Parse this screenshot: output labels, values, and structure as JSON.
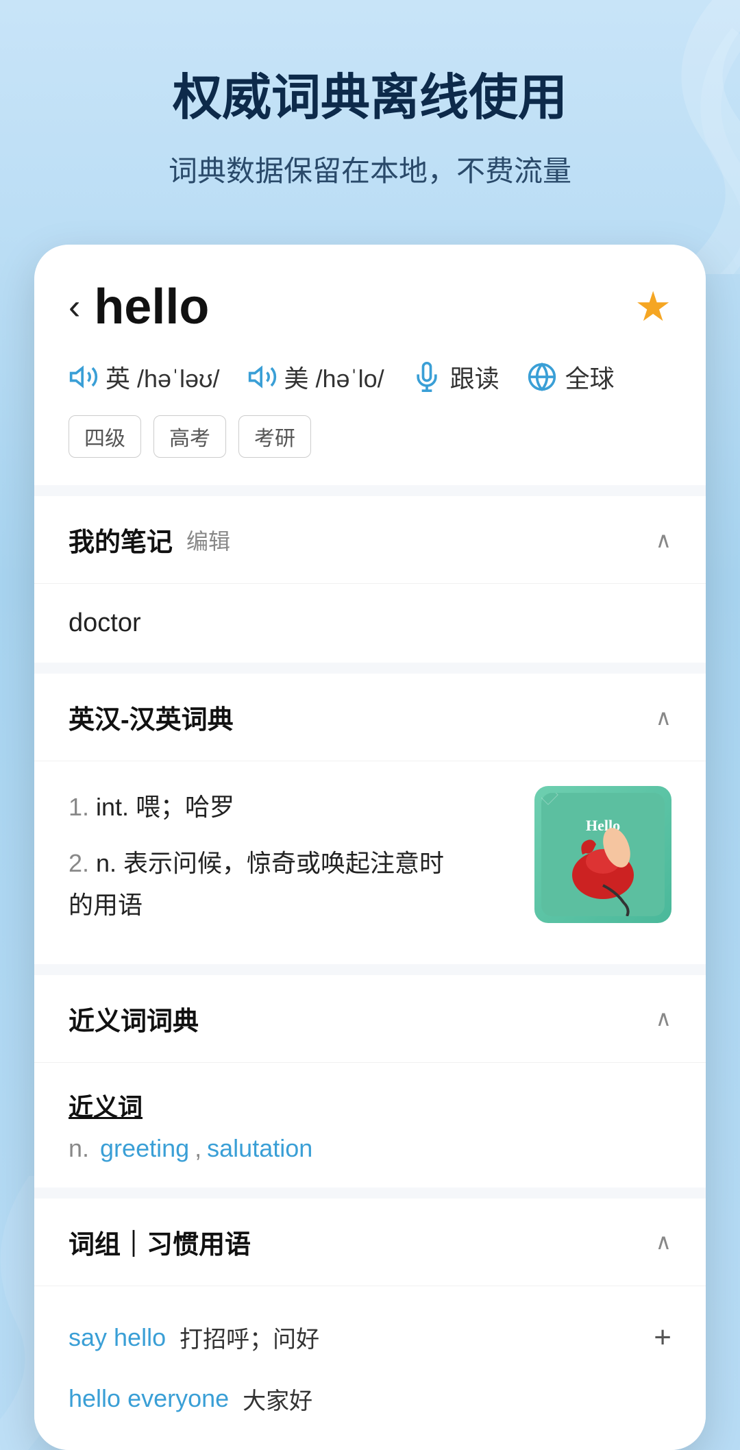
{
  "hero": {
    "title": "权威词典离线使用",
    "subtitle": "词典数据保留在本地，不费流量"
  },
  "word": {
    "back_label": "‹",
    "text": "hello",
    "star": "★",
    "pronunciations": [
      {
        "lang": "英",
        "phonetic": "/həˈləʊ/"
      },
      {
        "lang": "美",
        "phonetic": "/həˈlo/"
      }
    ],
    "actions": [
      {
        "label": "跟读"
      },
      {
        "label": "全球"
      }
    ],
    "tags": [
      "四级",
      "高考",
      "考研"
    ]
  },
  "sections": {
    "my_notes": {
      "title": "我的笔记",
      "edit": "编辑",
      "content": "doctor"
    },
    "en_cn_dict": {
      "title": "英汉-汉英词典",
      "definitions": [
        {
          "num": "1.",
          "pos": "int.",
          "text": "喂；哈罗"
        },
        {
          "num": "2.",
          "pos": "n.",
          "text": "表示问候，惊奇或唤起注意时的用语"
        }
      ]
    },
    "synonyms": {
      "title": "近义词词典",
      "label": "近义词",
      "pos": "n.",
      "words": [
        "greeting",
        "salutation"
      ]
    },
    "phrases": {
      "title": "词组｜习惯用语",
      "items": [
        {
          "phrase": "say hello",
          "meaning": "打招呼；问好"
        },
        {
          "phrase": "hello everyone",
          "meaning": "大家好"
        }
      ]
    }
  },
  "hello_image": {
    "label": "Hello",
    "bg_color": "#5cbfa0"
  }
}
